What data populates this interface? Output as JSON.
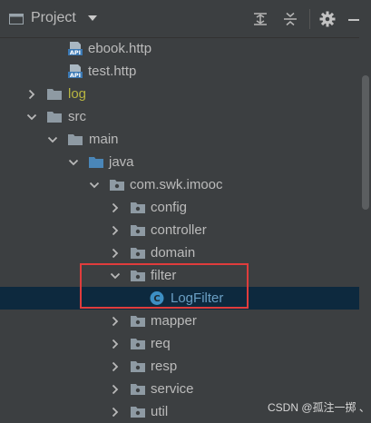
{
  "header": {
    "title": "Project",
    "icons": [
      "project-window-icon",
      "dropdown-caret-icon",
      "expand-all-icon",
      "collapse-all-icon",
      "gear-icon",
      "minimize-icon"
    ]
  },
  "tree": [
    {
      "label": "ebook.http",
      "type": "api-file",
      "expanded": null
    },
    {
      "label": "test.http",
      "type": "api-file",
      "expanded": null
    },
    {
      "label": "log",
      "type": "folder",
      "expanded": false,
      "color": "#b7b541"
    },
    {
      "label": "src",
      "type": "folder",
      "expanded": true
    },
    {
      "label": "main",
      "type": "folder",
      "expanded": true
    },
    {
      "label": "java",
      "type": "source-folder",
      "expanded": true
    },
    {
      "label": "com.swk.imooc",
      "type": "package",
      "expanded": true
    },
    {
      "label": "config",
      "type": "package",
      "expanded": false
    },
    {
      "label": "controller",
      "type": "package",
      "expanded": false
    },
    {
      "label": "domain",
      "type": "package",
      "expanded": false
    },
    {
      "label": "filter",
      "type": "package",
      "expanded": true
    },
    {
      "label": "LogFilter",
      "type": "class",
      "expanded": null,
      "selected": true
    },
    {
      "label": "mapper",
      "type": "package",
      "expanded": false
    },
    {
      "label": "req",
      "type": "package",
      "expanded": false
    },
    {
      "label": "resp",
      "type": "package",
      "expanded": false
    },
    {
      "label": "service",
      "type": "package",
      "expanded": false
    },
    {
      "label": "util",
      "type": "package",
      "expanded": false
    }
  ],
  "watermark": "CSDN @孤注一掷 、",
  "colors": {
    "background": "#3c3f41",
    "selection": "#0d293e",
    "highlight_border": "#e03c3c",
    "folder": "#8e9aa3",
    "source_folder": "#4a86b8",
    "class_icon": "#3d8fc4"
  }
}
